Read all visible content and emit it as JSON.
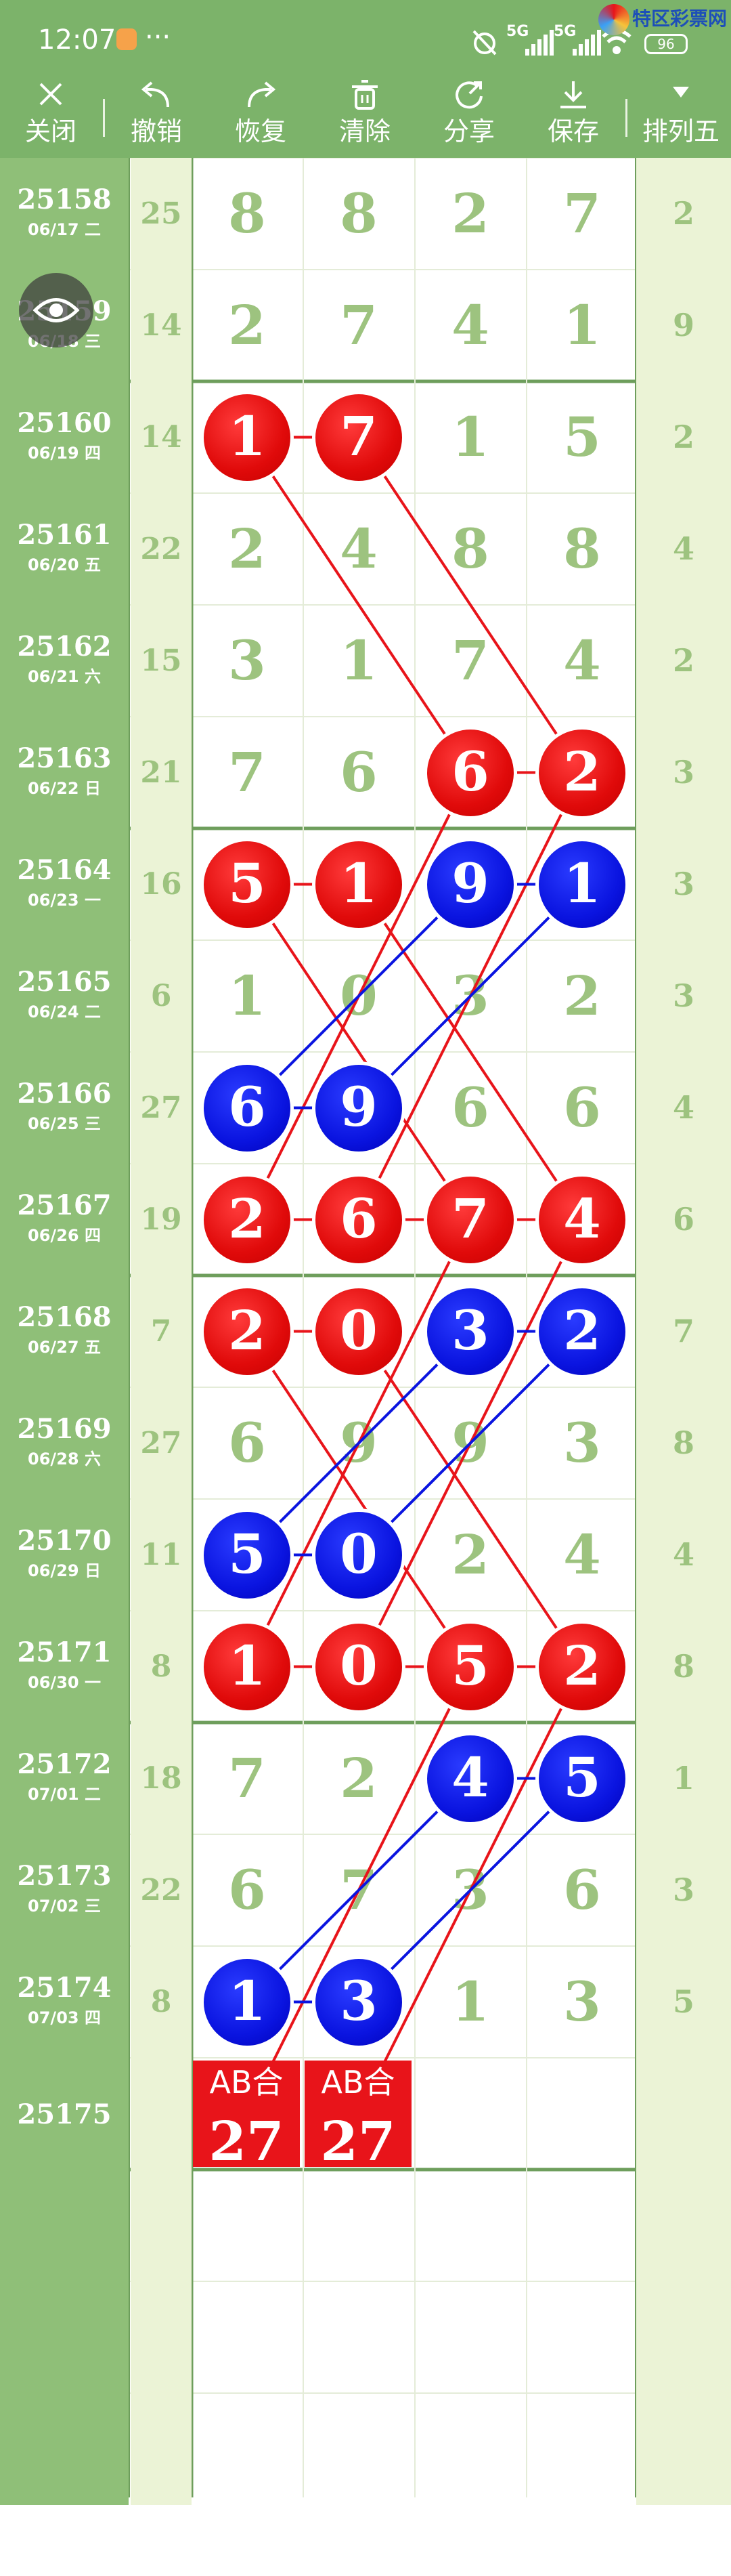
{
  "status": {
    "time": "12:07",
    "dots": "···",
    "net1": "5G",
    "net2": "5G",
    "brand": "特区彩票网",
    "battery": "96"
  },
  "toolbar": {
    "close": "关闭",
    "undo": "撤销",
    "redo": "恢复",
    "clear": "清除",
    "share": "分享",
    "save": "保存",
    "mode": "排列五"
  },
  "rows": [
    {
      "id": "25158",
      "date": "06/17 二",
      "sum": "25",
      "digits": [
        "8",
        "8",
        "2",
        "7"
      ],
      "last": "2"
    },
    {
      "id": "25159",
      "date": "06/18 三",
      "sum": "14",
      "digits": [
        "2",
        "7",
        "4",
        "1"
      ],
      "last": "9"
    },
    {
      "id": "25160",
      "date": "06/19 四",
      "sum": "14",
      "digits": [
        "1",
        "7",
        "1",
        "5"
      ],
      "last": "2"
    },
    {
      "id": "25161",
      "date": "06/20 五",
      "sum": "22",
      "digits": [
        "2",
        "4",
        "8",
        "8"
      ],
      "last": "4"
    },
    {
      "id": "25162",
      "date": "06/21 六",
      "sum": "15",
      "digits": [
        "3",
        "1",
        "7",
        "4"
      ],
      "last": "2"
    },
    {
      "id": "25163",
      "date": "06/22 日",
      "sum": "21",
      "digits": [
        "7",
        "6",
        "6",
        "2"
      ],
      "last": "3"
    },
    {
      "id": "25164",
      "date": "06/23 一",
      "sum": "16",
      "digits": [
        "5",
        "1",
        "9",
        "1"
      ],
      "last": "3"
    },
    {
      "id": "25165",
      "date": "06/24 二",
      "sum": "6",
      "digits": [
        "1",
        "0",
        "3",
        "2"
      ],
      "last": "3"
    },
    {
      "id": "25166",
      "date": "06/25 三",
      "sum": "27",
      "digits": [
        "6",
        "9",
        "6",
        "6"
      ],
      "last": "4"
    },
    {
      "id": "25167",
      "date": "06/26 四",
      "sum": "19",
      "digits": [
        "2",
        "6",
        "7",
        "4"
      ],
      "last": "6"
    },
    {
      "id": "25168",
      "date": "06/27 五",
      "sum": "7",
      "digits": [
        "2",
        "0",
        "3",
        "2"
      ],
      "last": "7"
    },
    {
      "id": "25169",
      "date": "06/28 六",
      "sum": "27",
      "digits": [
        "6",
        "9",
        "9",
        "3"
      ],
      "last": "8"
    },
    {
      "id": "25170",
      "date": "06/29 日",
      "sum": "11",
      "digits": [
        "5",
        "0",
        "2",
        "4"
      ],
      "last": "4"
    },
    {
      "id": "25171",
      "date": "06/30 一",
      "sum": "8",
      "digits": [
        "1",
        "0",
        "5",
        "2"
      ],
      "last": "8"
    },
    {
      "id": "25172",
      "date": "07/01 二",
      "sum": "18",
      "digits": [
        "7",
        "2",
        "4",
        "5"
      ],
      "last": "1"
    },
    {
      "id": "25173",
      "date": "07/02 三",
      "sum": "22",
      "digits": [
        "6",
        "7",
        "3",
        "6"
      ],
      "last": "3"
    },
    {
      "id": "25174",
      "date": "07/03 四",
      "sum": "8",
      "digits": [
        "1",
        "3",
        "1",
        "3"
      ],
      "last": "5"
    },
    {
      "id": "25175",
      "date": "",
      "sum": "",
      "digits": [
        "",
        "",
        "",
        ""
      ],
      "last": ""
    }
  ],
  "marked": [
    {
      "row": 2,
      "col": 0,
      "color": "red"
    },
    {
      "row": 2,
      "col": 1,
      "color": "red"
    },
    {
      "row": 5,
      "col": 2,
      "color": "red"
    },
    {
      "row": 5,
      "col": 3,
      "color": "red"
    },
    {
      "row": 6,
      "col": 0,
      "color": "red"
    },
    {
      "row": 6,
      "col": 1,
      "color": "red"
    },
    {
      "row": 6,
      "col": 2,
      "color": "blue"
    },
    {
      "row": 6,
      "col": 3,
      "color": "blue"
    },
    {
      "row": 8,
      "col": 0,
      "color": "blue"
    },
    {
      "row": 8,
      "col": 1,
      "color": "blue"
    },
    {
      "row": 9,
      "col": 0,
      "color": "red"
    },
    {
      "row": 9,
      "col": 1,
      "color": "red"
    },
    {
      "row": 9,
      "col": 2,
      "color": "red"
    },
    {
      "row": 9,
      "col": 3,
      "color": "red"
    },
    {
      "row": 10,
      "col": 0,
      "color": "red"
    },
    {
      "row": 10,
      "col": 1,
      "color": "red"
    },
    {
      "row": 10,
      "col": 2,
      "color": "blue"
    },
    {
      "row": 10,
      "col": 3,
      "color": "blue"
    },
    {
      "row": 12,
      "col": 0,
      "color": "blue"
    },
    {
      "row": 12,
      "col": 1,
      "color": "blue"
    },
    {
      "row": 13,
      "col": 0,
      "color": "red"
    },
    {
      "row": 13,
      "col": 1,
      "color": "red"
    },
    {
      "row": 13,
      "col": 2,
      "color": "red"
    },
    {
      "row": 13,
      "col": 3,
      "color": "red"
    },
    {
      "row": 14,
      "col": 2,
      "color": "blue"
    },
    {
      "row": 14,
      "col": 3,
      "color": "blue"
    },
    {
      "row": 16,
      "col": 0,
      "color": "blue"
    },
    {
      "row": 16,
      "col": 1,
      "color": "blue"
    }
  ],
  "ab_boxes": [
    {
      "col": 0,
      "label": "AB合",
      "value": "27"
    },
    {
      "col": 1,
      "label": "AB合",
      "value": "27"
    }
  ],
  "lines": [
    {
      "from": [
        2,
        0
      ],
      "to": [
        5,
        2
      ],
      "color": "red"
    },
    {
      "from": [
        2,
        1
      ],
      "to": [
        5,
        3
      ],
      "color": "red"
    },
    {
      "from": [
        5,
        2
      ],
      "to": [
        9,
        0
      ],
      "color": "red"
    },
    {
      "from": [
        5,
        3
      ],
      "to": [
        9,
        1
      ],
      "color": "red"
    },
    {
      "from": [
        6,
        0
      ],
      "to": [
        9,
        2
      ],
      "color": "red"
    },
    {
      "from": [
        6,
        1
      ],
      "to": [
        9,
        3
      ],
      "color": "red"
    },
    {
      "from": [
        6,
        2
      ],
      "to": [
        8,
        0
      ],
      "color": "blue"
    },
    {
      "from": [
        6,
        3
      ],
      "to": [
        8,
        1
      ],
      "color": "blue"
    },
    {
      "from": [
        9,
        2
      ],
      "to": [
        13,
        0
      ],
      "color": "red"
    },
    {
      "from": [
        9,
        3
      ],
      "to": [
        13,
        1
      ],
      "color": "red"
    },
    {
      "from": [
        10,
        0
      ],
      "to": [
        13,
        2
      ],
      "color": "red"
    },
    {
      "from": [
        10,
        1
      ],
      "to": [
        13,
        3
      ],
      "color": "red"
    },
    {
      "from": [
        10,
        2
      ],
      "to": [
        12,
        0
      ],
      "color": "blue"
    },
    {
      "from": [
        10,
        3
      ],
      "to": [
        12,
        1
      ],
      "color": "blue"
    },
    {
      "from": [
        13,
        2
      ],
      "to": [
        17,
        0
      ],
      "color": "red"
    },
    {
      "from": [
        13,
        3
      ],
      "to": [
        17,
        1
      ],
      "color": "red"
    },
    {
      "from": [
        14,
        2
      ],
      "to": [
        16,
        0
      ],
      "color": "blue"
    },
    {
      "from": [
        14,
        3
      ],
      "to": [
        16,
        1
      ],
      "color": "blue"
    }
  ],
  "colors": {
    "header": "#7cb36a",
    "id_column": "#8fbf78",
    "light_column": "#ebf3d6",
    "digit": "#9dc37f",
    "red": "#e8141a",
    "blue": "#0a14e0"
  },
  "icons": [
    "close-icon",
    "undo-icon",
    "redo-icon",
    "trash-icon",
    "share-icon",
    "download-icon",
    "caret-down-icon",
    "eye-icon",
    "alarm-off-icon",
    "wifi-icon"
  ]
}
